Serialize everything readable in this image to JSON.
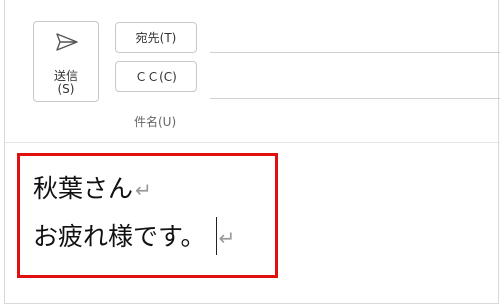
{
  "compose": {
    "send": {
      "label_line1": "送信",
      "label_line2": "(S)"
    },
    "to_button": "宛先(T)",
    "cc_button": "ＣＣ(C)",
    "subject_label": "件名(U)"
  },
  "body": {
    "line1": "秋葉さん",
    "line2": "お疲れ様です。",
    "return_mark": "↵",
    "highlight_color": "#e01010"
  }
}
